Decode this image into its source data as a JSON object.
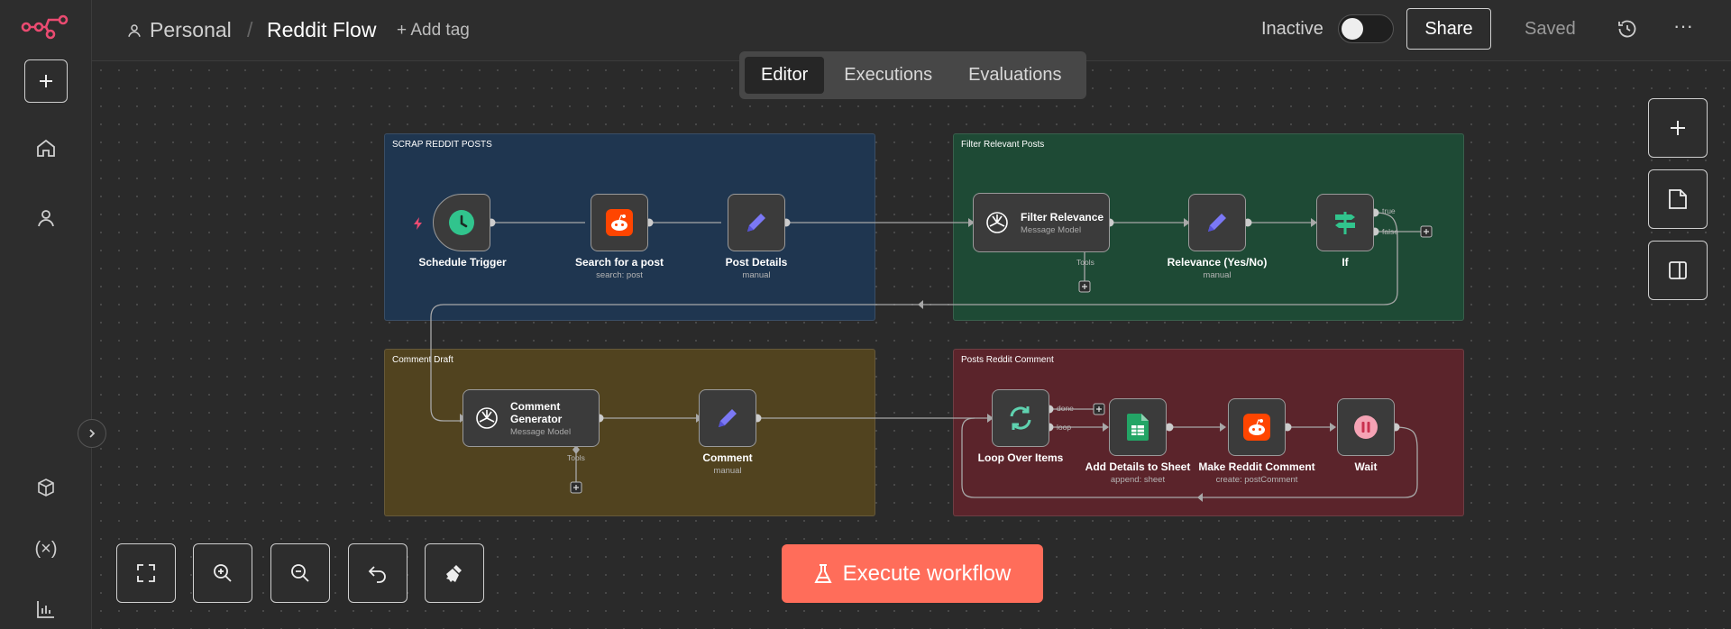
{
  "header": {
    "project": "Personal",
    "separator": "/",
    "workflow_name": "Reddit Flow",
    "add_tag": "+ Add tag",
    "status": "Inactive",
    "share": "Share",
    "saved": "Saved",
    "more": "···"
  },
  "tabs": [
    "Editor",
    "Executions",
    "Evaluations"
  ],
  "groups": {
    "scrap": "SCRAP REDDIT POSTS",
    "filter": "Filter Relevant Posts",
    "draft": "Comment Draft",
    "post": "Posts Reddit Comment"
  },
  "nodes": {
    "schedule": {
      "title": "Schedule Trigger"
    },
    "search": {
      "title": "Search for a post",
      "sub": "search: post"
    },
    "post_details": {
      "title": "Post Details",
      "sub": "manual"
    },
    "filter_relevance": {
      "title": "Filter Relevance",
      "sub": "Message Model",
      "tools": "Tools"
    },
    "relevance": {
      "title": "Relevance (Yes/No)",
      "sub": "manual"
    },
    "if": {
      "title": "If",
      "true": "true",
      "false": "false"
    },
    "generator": {
      "title": "Comment Generator",
      "sub": "Message Model",
      "tools": "Tools"
    },
    "comment": {
      "title": "Comment",
      "sub": "manual"
    },
    "loop": {
      "title": "Loop Over Items",
      "done": "done",
      "loop": "loop"
    },
    "sheet": {
      "title": "Add Details to Sheet",
      "sub": "append: sheet"
    },
    "reddit_comment": {
      "title": "Make Reddit Comment",
      "sub": "create: postComment"
    },
    "wait": {
      "title": "Wait"
    }
  },
  "execute": "Execute workflow",
  "colors": {
    "accent": "#ff6d5a",
    "group_blue": "#1f3650",
    "group_green": "#1e4a35",
    "group_yellow": "#51431f",
    "group_red": "#5b242b"
  }
}
